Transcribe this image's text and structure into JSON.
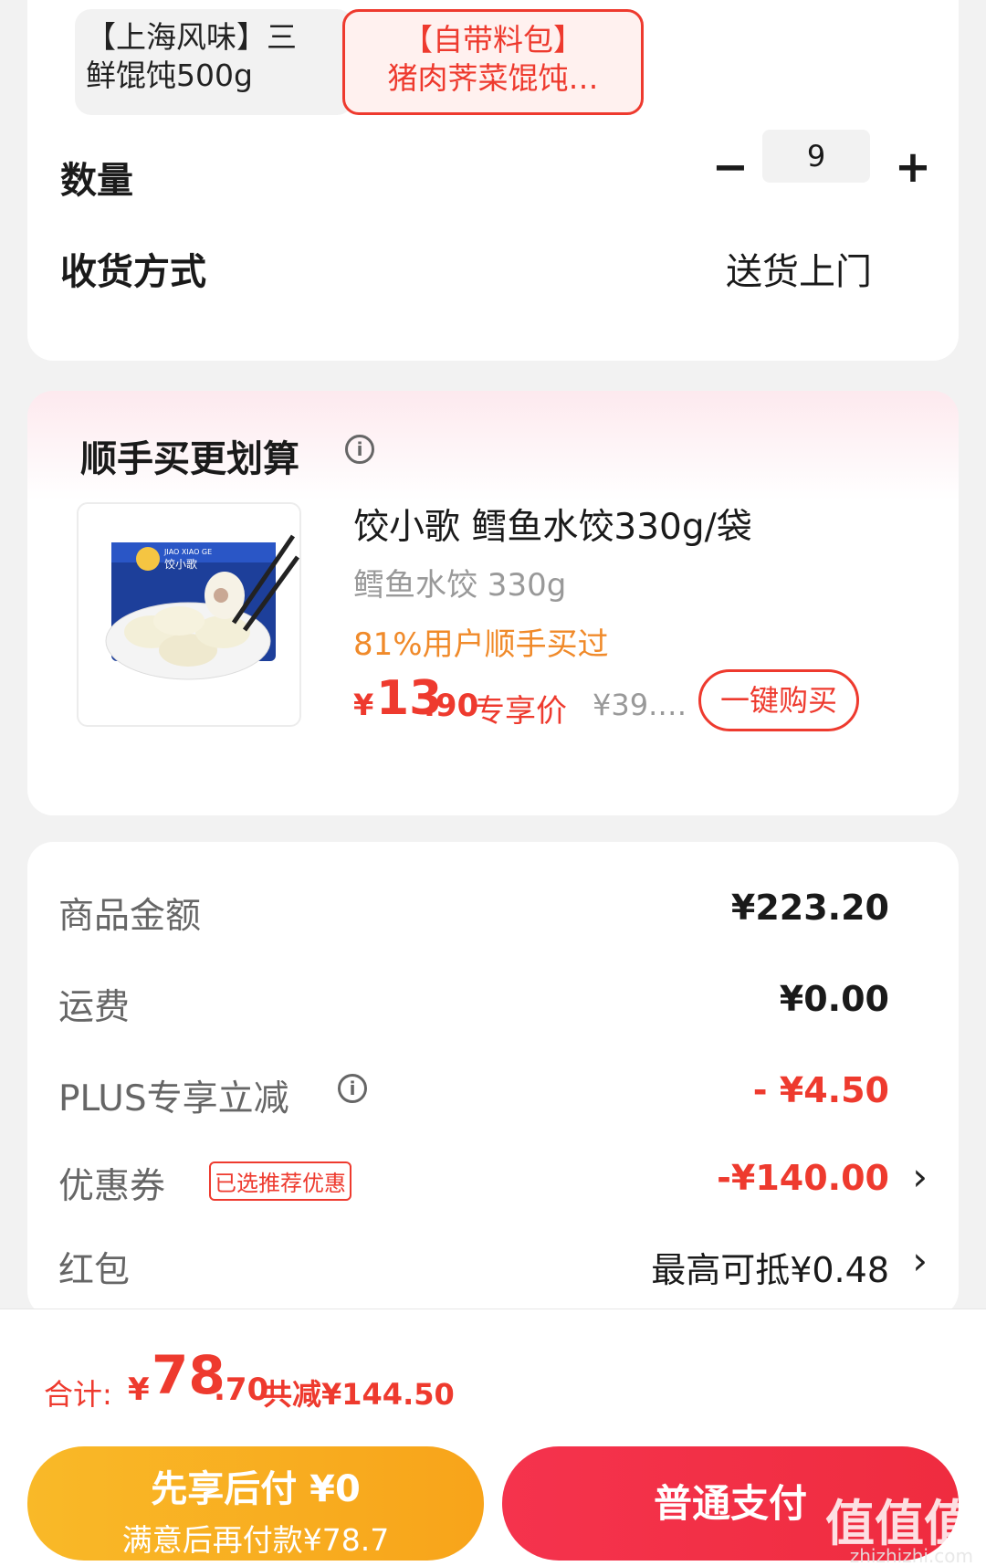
{
  "options": {
    "option_a_line1": "【上海风味】三",
    "option_a_line2": "鲜馄饨500g",
    "option_b_line1": "【自带料包】",
    "option_b_line2": "猪肉荠菜馄饨…"
  },
  "quantity": {
    "label": "数量",
    "minus": "−",
    "value": "9",
    "plus": "+"
  },
  "delivery": {
    "label": "收货方式",
    "value": "送货上门"
  },
  "upsell": {
    "title": "顺手买更划算",
    "info_icon": "i",
    "product": {
      "name": "饺小歌 鳕鱼水饺330g/袋",
      "spec": "鳕鱼水饺 330g",
      "rate_text": "81%用户顺手买过",
      "price_currency": "¥",
      "price_int": "13",
      "price_dec": ".90",
      "price_tag": "专享价",
      "orig_price": "¥39.…",
      "buy_label": "一键购买",
      "image_brand": "饺小歌",
      "image_brand_en": "JIAO XIAO GE"
    }
  },
  "summary": {
    "goods_label": "商品金额",
    "goods_value": "¥223.20",
    "shipping_label": "运费",
    "shipping_value": "¥0.00",
    "plus_label": "PLUS专享立减",
    "plus_value": "- ¥4.50",
    "coupon_label": "优惠券",
    "coupon_badge": "已选推荐优惠",
    "coupon_value": "-¥140.00",
    "hongbao_label": "红包",
    "hongbao_value": "最高可抵¥0.48",
    "chevron": "›"
  },
  "footer": {
    "total_label": "合计:",
    "total_currency": "¥",
    "total_int": "78",
    "total_dec": ".70",
    "total_reduce": "共减¥144.50",
    "pay_later_line1": "先享后付 ¥0",
    "pay_later_line2": "满意后再付款¥78.7",
    "pay_normal": "普通支付",
    "watermark": "值值值",
    "watermark_sub": "zhizhizhi.com"
  },
  "colors": {
    "accent_red": "#ee3a2e",
    "orange": "#f08a2a",
    "pay_later_yellow": "#f9b928"
  }
}
